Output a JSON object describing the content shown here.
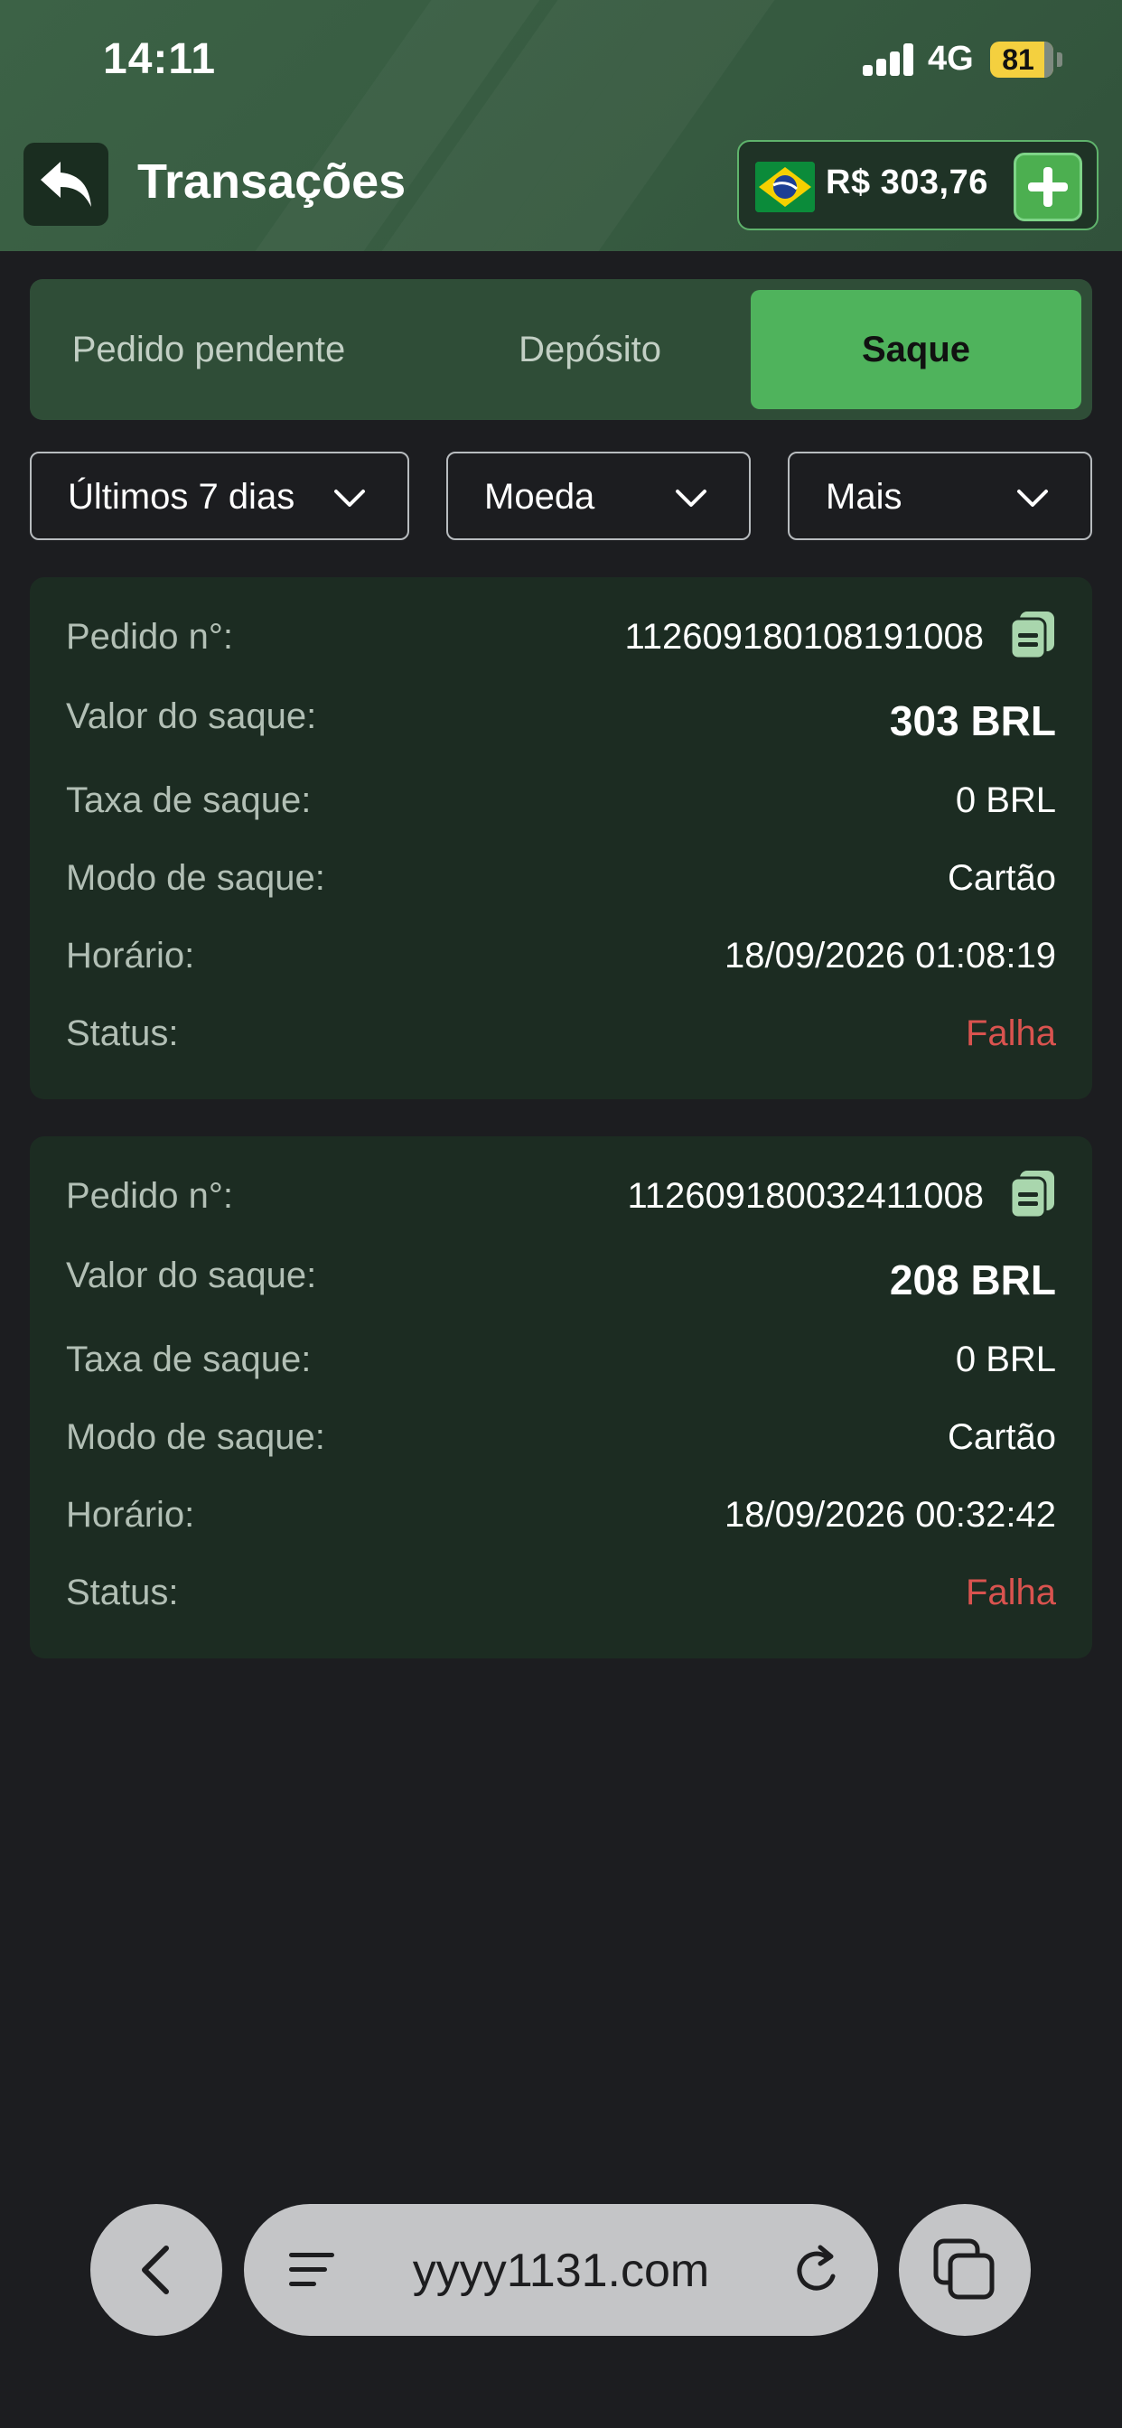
{
  "status_bar": {
    "time": "14:11",
    "network": "4G",
    "battery": "81"
  },
  "header": {
    "title": "Transações",
    "balance": "R$ 303,76",
    "back_icon": "reply-arrow-icon",
    "flag_icon": "brazil-flag-icon",
    "add_icon": "plus-icon"
  },
  "tabs": [
    {
      "label": "Pedido pendente",
      "active": false
    },
    {
      "label": "Depósito",
      "active": false
    },
    {
      "label": "Saque",
      "active": true
    }
  ],
  "filters": [
    {
      "label": "Últimos 7 dias"
    },
    {
      "label": "Moeda"
    },
    {
      "label": "Mais"
    }
  ],
  "labels": {
    "order": "Pedido n°:",
    "amount": "Valor do saque:",
    "fee": "Taxa de saque:",
    "mode": "Modo de saque:",
    "time": "Horário:",
    "status": "Status:"
  },
  "transactions": [
    {
      "order": "112609180108191008",
      "amount": "303 BRL",
      "fee": "0 BRL",
      "mode": "Cartão",
      "time": "18/09/2026 01:08:19",
      "status": "Falha"
    },
    {
      "order": "112609180032411008",
      "amount": "208 BRL",
      "fee": "0 BRL",
      "mode": "Cartão",
      "time": "18/09/2026 00:32:42",
      "status": "Falha"
    }
  ],
  "browser": {
    "url": "yyyy1131.com"
  },
  "colors": {
    "accent": "#4fb35c",
    "header_bg": "#3c6246",
    "card_bg": "#1c2c22",
    "fail": "#d9534f"
  }
}
